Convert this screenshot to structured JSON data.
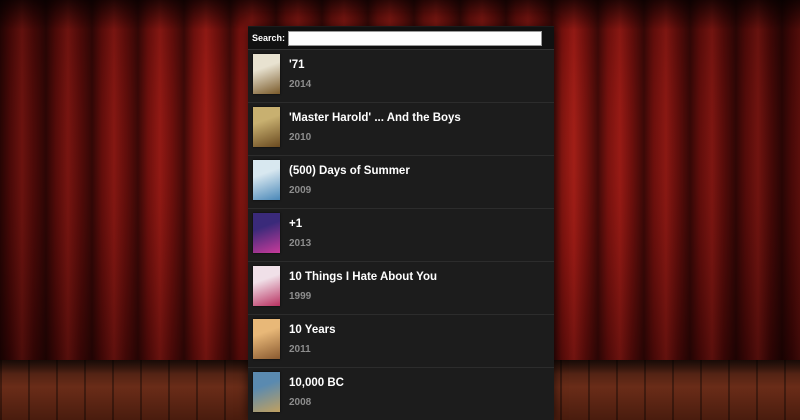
{
  "search": {
    "label": "Search:",
    "value": "",
    "placeholder": ""
  },
  "movies": [
    {
      "title": "'71",
      "year": "2014",
      "poster_colors": [
        "#e8e2d0",
        "#7a5a2a"
      ]
    },
    {
      "title": "'Master Harold' ... And the Boys",
      "year": "2010",
      "poster_colors": [
        "#c8b070",
        "#6a4a20"
      ]
    },
    {
      "title": "(500) Days of Summer",
      "year": "2009",
      "poster_colors": [
        "#d8e8f0",
        "#4a88b8"
      ]
    },
    {
      "title": "+1",
      "year": "2013",
      "poster_colors": [
        "#3a2a7a",
        "#c83a9a"
      ]
    },
    {
      "title": "10 Things I Hate About You",
      "year": "1999",
      "poster_colors": [
        "#f0e0e8",
        "#b83060"
      ]
    },
    {
      "title": "10 Years",
      "year": "2011",
      "poster_colors": [
        "#e8b878",
        "#8a5a30"
      ]
    },
    {
      "title": "10,000 BC",
      "year": "2008",
      "poster_colors": [
        "#5a8ab0",
        "#c0a060"
      ]
    }
  ]
}
